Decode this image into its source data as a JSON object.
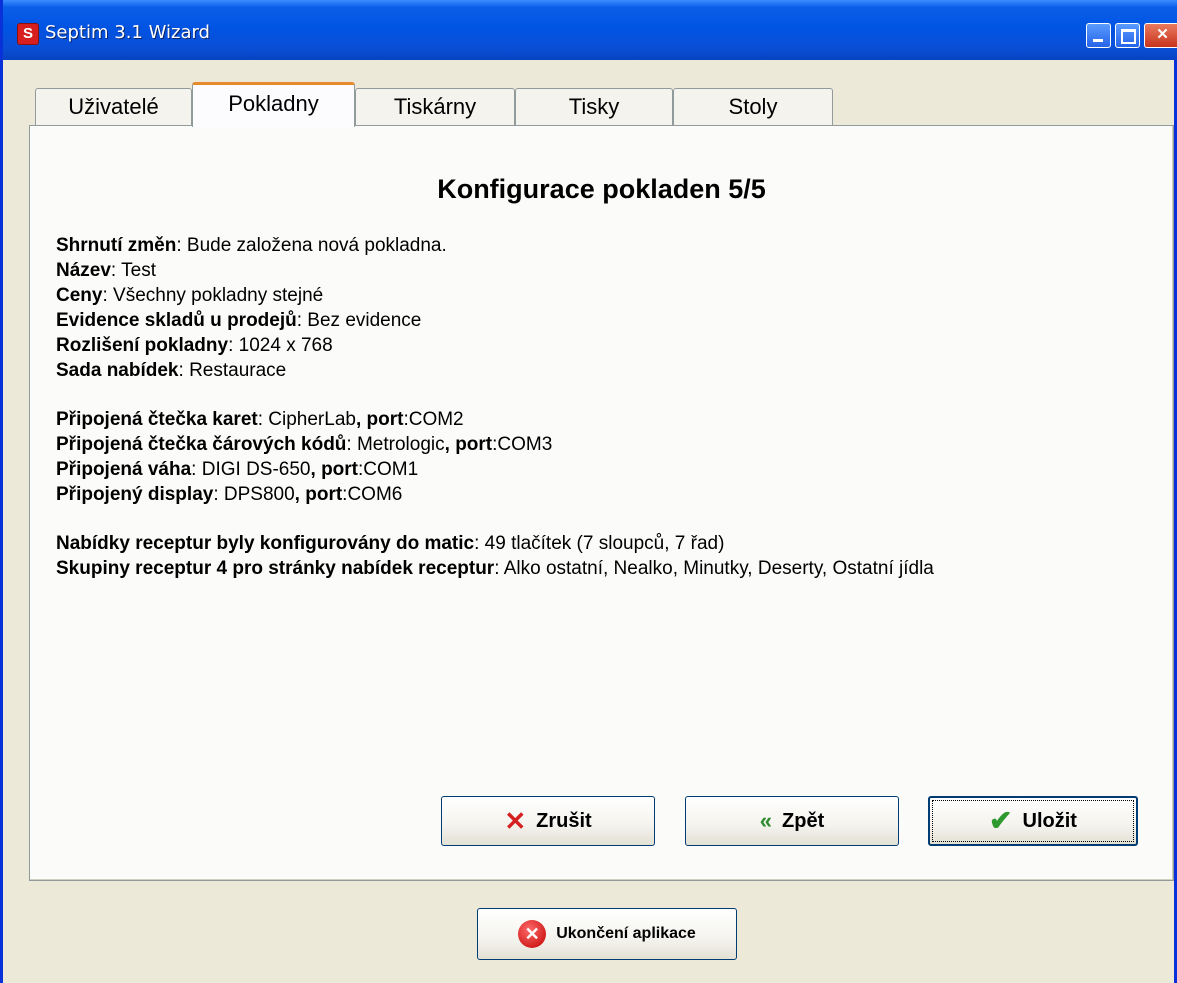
{
  "window": {
    "title": "Septim 3.1 Wizard",
    "app_icon_letter": "S"
  },
  "tabs": [
    {
      "label": "Uživatelé"
    },
    {
      "label": "Pokladny"
    },
    {
      "label": "Tiskárny"
    },
    {
      "label": "Tisky"
    },
    {
      "label": "Stoly"
    }
  ],
  "active_tab": "Pokladny",
  "panel": {
    "heading": "Konfigurace pokladen 5/5",
    "summary": [
      {
        "key": "Shrnutí změn",
        "value": "Bude založena nová pokladna."
      },
      {
        "key": "Název",
        "value": "Test"
      },
      {
        "key": "Ceny",
        "value": "Všechny pokladny stejné"
      },
      {
        "key": "Evidence skladů u prodejů",
        "value": "Bez evidence"
      },
      {
        "key": "Rozlišení pokladny",
        "value": "1024 x 768"
      },
      {
        "key": "Sada nabídek",
        "value": "Restaurace"
      }
    ],
    "devices": [
      {
        "key": "Připojená čtečka karet",
        "value": "CipherLab",
        "port_label": "port",
        "port": "COM2"
      },
      {
        "key": "Připojená čtečka čárových kódů",
        "value": "Metrologic",
        "port_label": "port",
        "port": "COM3"
      },
      {
        "key": "Připojená váha",
        "value": "DIGI DS-650",
        "port_label": "port",
        "port": "COM1"
      },
      {
        "key": "Připojený display",
        "value": "DPS800",
        "port_label": "port",
        "port": "COM6"
      }
    ],
    "recipes": [
      {
        "key": "Nabídky receptur byly konfigurovány do matic",
        "value": "49 tlačítek (7 sloupců, 7 řad)"
      },
      {
        "key": "Skupiny receptur 4 pro stránky nabídek receptur",
        "value": "Alko ostatní, Nealko, Minutky, Deserty, Ostatní jídla"
      }
    ]
  },
  "buttons": {
    "cancel": "Zrušit",
    "back": "Zpět",
    "save": "Uložit",
    "exit": "Ukončení aplikace"
  },
  "icons": {
    "cancel": "x-icon",
    "back": "double-chevron-left-icon",
    "save": "checkmark-icon",
    "exit": "exit-icon"
  },
  "colors": {
    "title_bar": "#0054e3",
    "active_tab_accent": "#e68b2c",
    "cancel_icon": "#d42020",
    "ok_icon": "#2e9a2e"
  }
}
